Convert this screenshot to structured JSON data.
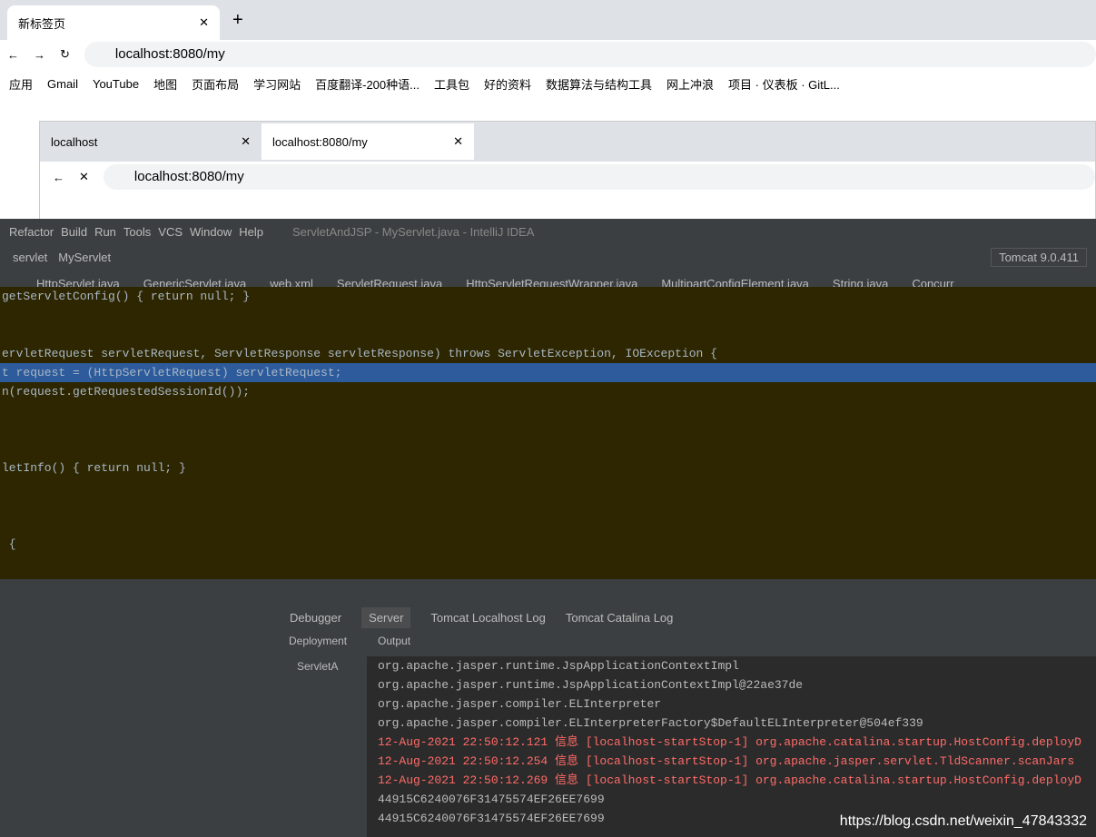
{
  "outer": {
    "tab": "新标签页",
    "url": "localhost:8080/my"
  },
  "bookmarks": [
    "应用",
    "Gmail",
    "YouTube",
    "地图",
    "页面布局",
    "学习网站",
    "百度翻译-200种语...",
    "工具包",
    "好的资料",
    "数据算法与结构工具",
    "网上冲浪",
    "项目 · 仪表板 · GitL..."
  ],
  "inner": {
    "tabs": [
      "localhost",
      "localhost:8080/my"
    ],
    "url": "localhost:8080/my"
  },
  "menu": [
    "Refactor",
    "Build",
    "Run",
    "Tools",
    "VCS",
    "Window",
    "Help"
  ],
  "title": "ServletAndJSP - MyServlet.java - IntelliJ IDEA",
  "crumbs": [
    "servlet",
    "MyServlet"
  ],
  "run": "Tomcat 9.0.411",
  "files": [
    "HttpServlet.java",
    "GenericServlet.java",
    "web.xml",
    "ServletRequest.java",
    "HttpServletRequestWrapper.java",
    "MultipartConfigElement.java",
    "String.java",
    "Concurr"
  ],
  "code": [
    "getServletConfig() { return null; }",
    "",
    "",
    "ervletRequest servletRequest, ServletResponse servletResponse) throws ServletException, IOException {",
    "t request = (HttpServletRequest) servletRequest;",
    "n(request.getRequestedSessionId());",
    "",
    "",
    "",
    "letInfo() { return null; }",
    "",
    "",
    "",
    " {"
  ],
  "tool": {
    "tabs": [
      "Debugger",
      "Server",
      "Tomcat Localhost Log",
      "Tomcat Catalina Log"
    ],
    "deployment": "Deployment",
    "output": "Output",
    "item": "ServletA"
  },
  "console": [
    "org.apache.jasper.runtime.JspApplicationContextImpl",
    "org.apache.jasper.runtime.JspApplicationContextImpl@22ae37de",
    "org.apache.jasper.compiler.ELInterpreter",
    "org.apache.jasper.compiler.ELInterpreterFactory$DefaultELInterpreter@504ef339",
    "12-Aug-2021 22:50:12.121 信息 [localhost-startStop-1] org.apache.catalina.startup.HostConfig.deployD",
    "12-Aug-2021 22:50:12.254 信息 [localhost-startStop-1] org.apache.jasper.servlet.TldScanner.scanJars",
    "12-Aug-2021 22:50:12.269 信息 [localhost-startStop-1] org.apache.catalina.startup.HostConfig.deployD",
    "44915C6240076F31475574EF26EE7699",
    "44915C6240076F31475574EF26EE7699"
  ],
  "watermark": "https://blog.csdn.net/weixin_47843332"
}
